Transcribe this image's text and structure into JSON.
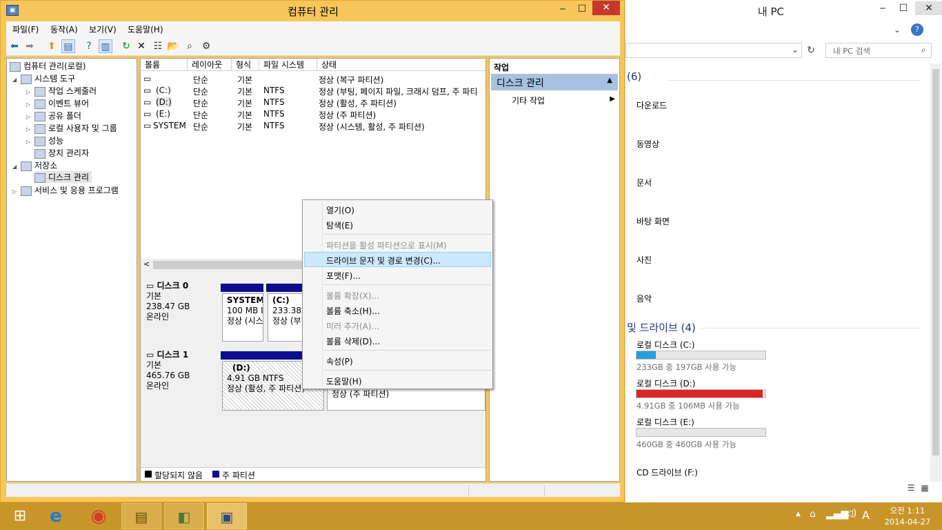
{
  "bg_window": {
    "title": "내 PC",
    "search_placeholder": "내 PC 검색",
    "folders_header": "(6)",
    "folders": [
      "다운로드",
      "동영상",
      "문서",
      "바탕 화면",
      "사진",
      "음악"
    ],
    "drives_header": "및 드라이브 (4)",
    "drives": [
      {
        "name": "로컬 디스크 (C:)",
        "free": "233GB 중 197GB 사용 가능",
        "used_fraction": 0.15,
        "color": "#26a0da"
      },
      {
        "name": "로컬 디스크 (D:)",
        "free": "4.91GB 중 106MB 사용 가능",
        "used_fraction": 0.98,
        "color": "#da2626"
      },
      {
        "name": "로컬 디스크 (E:)",
        "free": "460GB 중 460GB 사용 가능",
        "used_fraction": 0.0,
        "color": "#26a0da"
      }
    ],
    "cd_drive": "CD 드라이브 (F:)"
  },
  "main": {
    "title": "컴퓨터 관리",
    "menu": [
      "파일(F)",
      "동작(A)",
      "보기(V)",
      "도움말(H)"
    ],
    "tree": [
      {
        "label": "컴퓨터 관리(로컬)"
      },
      {
        "label": "시스템 도구"
      },
      {
        "label": "작업 스케줄러"
      },
      {
        "label": "이벤트 뷰어"
      },
      {
        "label": "공유 폴더"
      },
      {
        "label": "로컬 사용자 및 그룹"
      },
      {
        "label": "성능"
      },
      {
        "label": "장치 관리자"
      },
      {
        "label": "저장소"
      },
      {
        "label": "디스크 관리"
      },
      {
        "label": "서비스 및 응용 프로그램"
      }
    ],
    "columns": [
      "볼륨",
      "레이아웃",
      "형식",
      "파일 시스템",
      "상태"
    ],
    "volumes": [
      {
        "name": "",
        "layout": "단순",
        "type": "기본",
        "fs": "",
        "status": "정상 (복구 파티션)"
      },
      {
        "name": "(C:)",
        "layout": "단순",
        "type": "기본",
        "fs": "NTFS",
        "status": "정상 (부팅, 페이지 파일, 크래시 덤프, 주 파티"
      },
      {
        "name": "(D:)",
        "layout": "단순",
        "type": "기본",
        "fs": "NTFS",
        "status": "정상 (활성, 주 파티션)"
      },
      {
        "name": "(E:)",
        "layout": "단순",
        "type": "기본",
        "fs": "NTFS",
        "status": "정상 (주 파티션)"
      },
      {
        "name": "SYSTEM",
        "layout": "단순",
        "type": "기본",
        "fs": "NTFS",
        "status": "정상 (시스템, 활성, 주 파티션)"
      }
    ],
    "disk0": {
      "name": "디스크 0",
      "type": "기본",
      "size": "238.47 GB",
      "state": "온라인",
      "p1": {
        "name": "SYSTEM",
        "size": "100 MB I",
        "status": "정상 (시스"
      },
      "p2": {
        "name": "(C:)",
        "size": "233.38 G",
        "status": "정상 (부팅"
      }
    },
    "disk1": {
      "name": "디스크 1",
      "type": "기본",
      "size": "465.76 GB",
      "state": "온라인",
      "p1": {
        "name": "(D:)",
        "size": "4.91 GB NTFS",
        "status": "정상 (활성, 주 파티션)"
      },
      "p2": {
        "status": "정상 (주 파티션)"
      }
    },
    "legend": {
      "unallocated": "할당되지 않음",
      "primary": "주 파티션"
    },
    "actions_title": "작업",
    "actions_section": "디스크 관리",
    "actions_more": "기타 작업"
  },
  "context_menu": {
    "items": [
      {
        "label": "열기(O)"
      },
      {
        "label": "탐색(E)"
      },
      {
        "label": "파티션을 활성 파티션으로 표시(M)"
      },
      {
        "label": "드라이브 문자 및 경로 변경(C)..."
      },
      {
        "label": "포맷(F)..."
      },
      {
        "label": "볼륨 확장(X)..."
      },
      {
        "label": "볼륨 축소(H)..."
      },
      {
        "label": "미러 추가(A)..."
      },
      {
        "label": "볼륨 삭제(D)..."
      },
      {
        "label": "속성(P)"
      },
      {
        "label": "도움말(H)"
      }
    ]
  },
  "taskbar": {
    "time": "오전 1:11",
    "date": "2014-04-27",
    "ime": "A"
  },
  "colors": {
    "accent": "#f6c65a",
    "taskbar": "#c8952a",
    "partition_bar": "#0c0c8c",
    "menu_highlight": "#cce8ff"
  }
}
